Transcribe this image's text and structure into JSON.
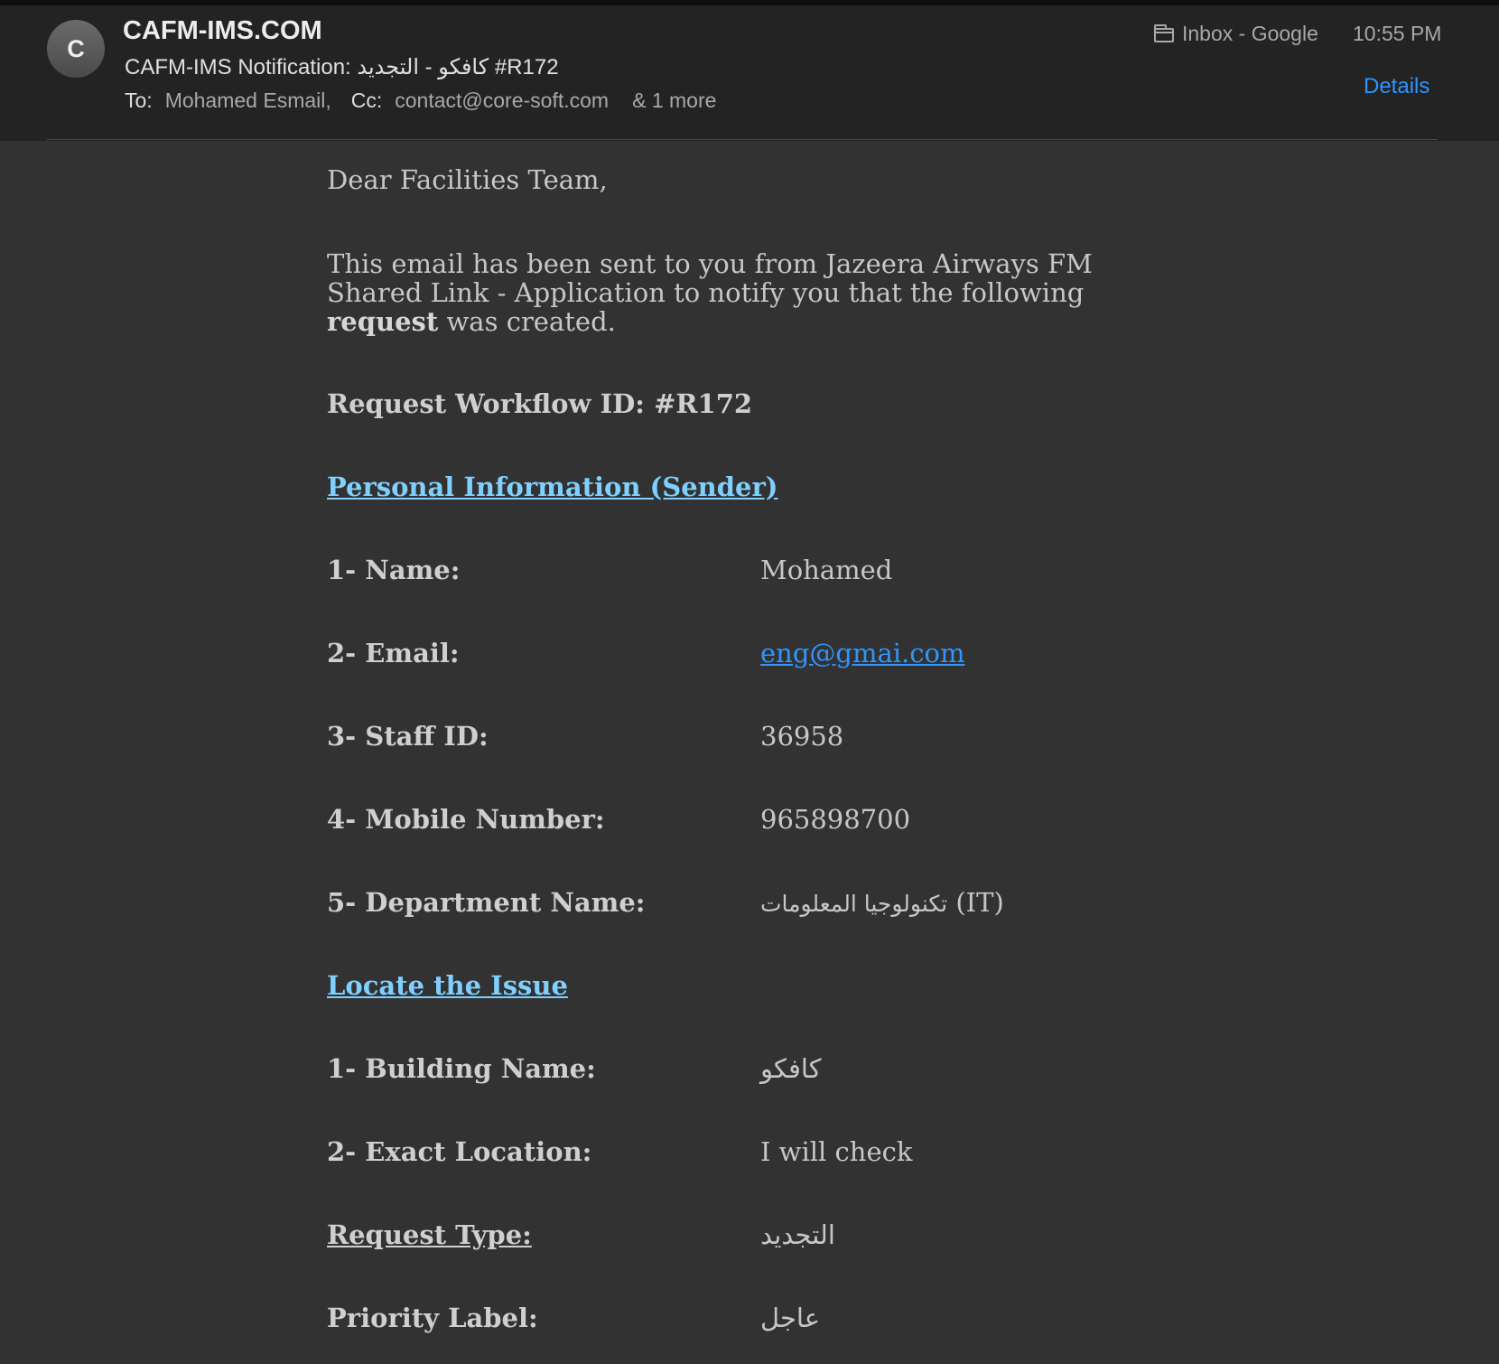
{
  "header": {
    "avatar_letter": "C",
    "sender": "CAFM-IMS.COM",
    "subject": "CAFM-IMS Notification: كافكو - التجديد #R172",
    "to_label": "To:",
    "to_value": "Mohamed Esmail,",
    "cc_label": "Cc:",
    "cc_value": "contact@core-soft.com",
    "more": "& 1 more",
    "mailbox": "Inbox - Google",
    "time": "10:55 PM",
    "details_label": "Details"
  },
  "email": {
    "greeting": "Dear Facilities Team,",
    "intro_before": "This email has been sent to you from Jazeera Airways FM Shared Link - Application to notify you that the following ",
    "intro_bold": "request",
    "intro_after": "  was created.",
    "workflow_label": "Request Workflow ID:",
    "workflow_id": "#R172",
    "section_personal": "Personal Information (Sender)",
    "name_label": "1- Name:",
    "name_value": "Mohamed",
    "email_label": "2- Email:",
    "email_value": "eng@gmai.com",
    "staff_label": "3- Staff ID:",
    "staff_value": "36958",
    "mobile_label": "4- Mobile Number:",
    "mobile_value": "965898700",
    "dept_label": "5- Department Name:",
    "dept_value_ar": "تكنولوجيا المعلومات",
    "dept_value_en": "(IT)",
    "section_locate": "Locate the Issue",
    "building_label": "1- Building Name:",
    "building_value": "كافكو",
    "location_label": "2- Exact Location:",
    "location_value": "I will check",
    "request_type_label": "Request Type:",
    "request_type_value": "التجديد",
    "priority_label": "Priority Label:",
    "priority_value": "عاجل"
  },
  "colors": {
    "link_blue": "#2f95ff",
    "section_link": "#7fd0ff",
    "background": "#323232",
    "header_bg": "#232323"
  }
}
